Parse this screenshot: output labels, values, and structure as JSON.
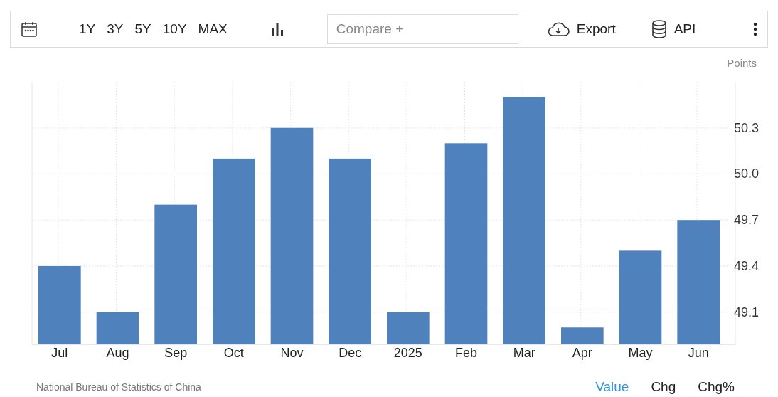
{
  "toolbar": {
    "ranges": [
      "1Y",
      "3Y",
      "5Y",
      "10Y",
      "MAX"
    ],
    "compare": {
      "placeholder": "Compare +"
    },
    "export": "Export",
    "api": "API"
  },
  "chart": {
    "unit": "Points",
    "chart_data": {
      "type": "bar",
      "categories": [
        "Jul",
        "Aug",
        "Sep",
        "Oct",
        "Nov",
        "Dec",
        "2025",
        "Feb",
        "Mar",
        "Apr",
        "May",
        "Jun"
      ],
      "grid": true,
      "series": [
        {
          "color": "#4f81bd",
          "values": [
            49.4,
            49.1,
            49.8,
            50.1,
            50.3,
            50.1,
            49.1,
            50.2,
            50.5,
            49.0,
            49.5,
            49.7
          ]
        }
      ],
      "ylim": [
        48.89,
        50.6
      ],
      "yticks": [
        {
          "value": 49.1,
          "label": "49.1"
        },
        {
          "value": 49.4,
          "label": "49.4"
        },
        {
          "value": 49.7,
          "label": "49.7"
        },
        {
          "value": 50.0,
          "label": "50.0"
        },
        {
          "value": 50.3,
          "label": "50.3"
        }
      ]
    }
  },
  "source": "National Bureau of Statistics of China",
  "views": [
    {
      "label": "Value",
      "selected": true
    },
    {
      "label": "Chg",
      "selected": false
    },
    {
      "label": "Chg%",
      "selected": false
    }
  ]
}
